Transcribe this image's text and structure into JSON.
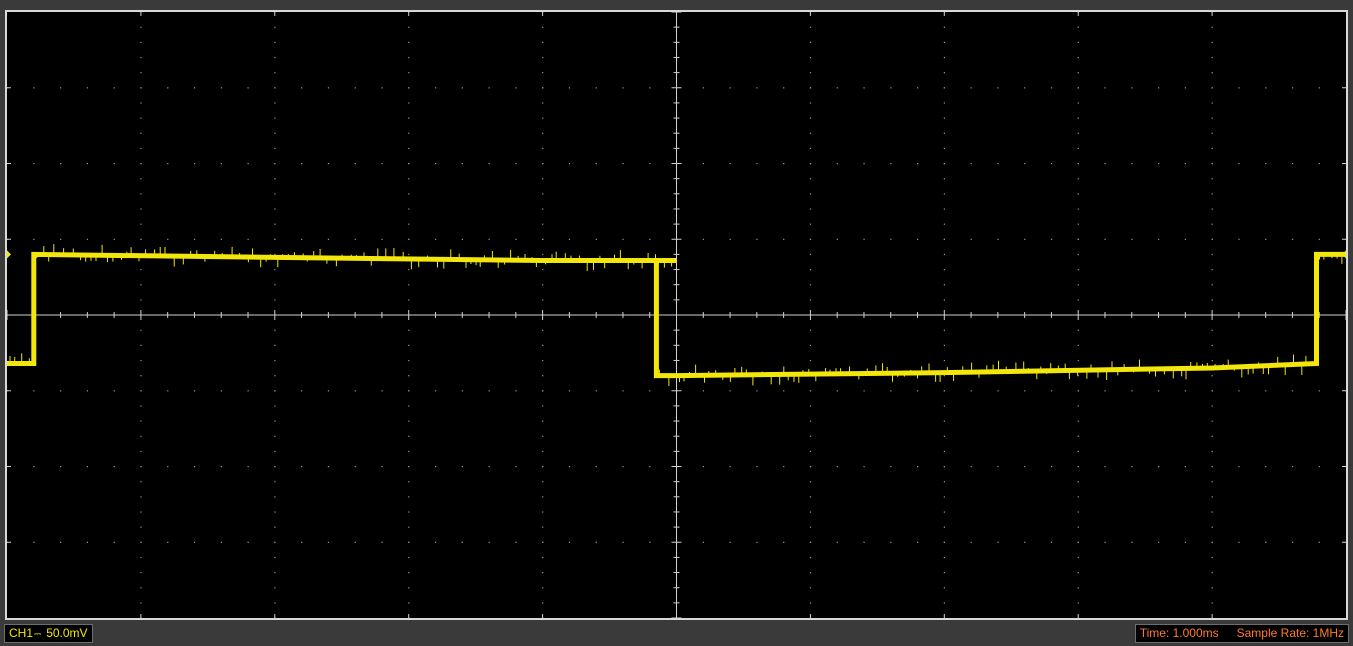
{
  "channel": {
    "name": "CH1",
    "coupling_icon": "dc-coupling-icon",
    "volts_per_div": "50.0mV",
    "color": "#f2e60a"
  },
  "timebase": {
    "time_label": "Time: 1.000ms",
    "sample_rate_label": "Sample Rate: 1MHz",
    "color": "#ff7a2a"
  },
  "display": {
    "background": "#000000",
    "grid_color": "#9a9a9a",
    "axis_color": "#d0d0d0",
    "horizontal_divisions": 10,
    "vertical_divisions": 8
  },
  "chart_data": {
    "type": "line",
    "title": "",
    "xlabel": "",
    "ylabel": "",
    "x_unit": "ms",
    "y_unit": "mV",
    "xlim": [
      -5.0,
      5.0
    ],
    "ylim": [
      -200,
      200
    ],
    "series": [
      {
        "color": "#f2e60a",
        "x": [
          -5.0,
          -4.8,
          -4.8,
          -3.0,
          -1.0,
          0.0,
          -0.15,
          -0.15,
          0.0,
          2.0,
          4.0,
          4.78,
          4.78,
          5.0
        ],
        "y": [
          -32,
          -32,
          40,
          38,
          36,
          36,
          36,
          -40,
          -40,
          -38,
          -35,
          -32,
          40,
          40
        ]
      }
    ]
  }
}
